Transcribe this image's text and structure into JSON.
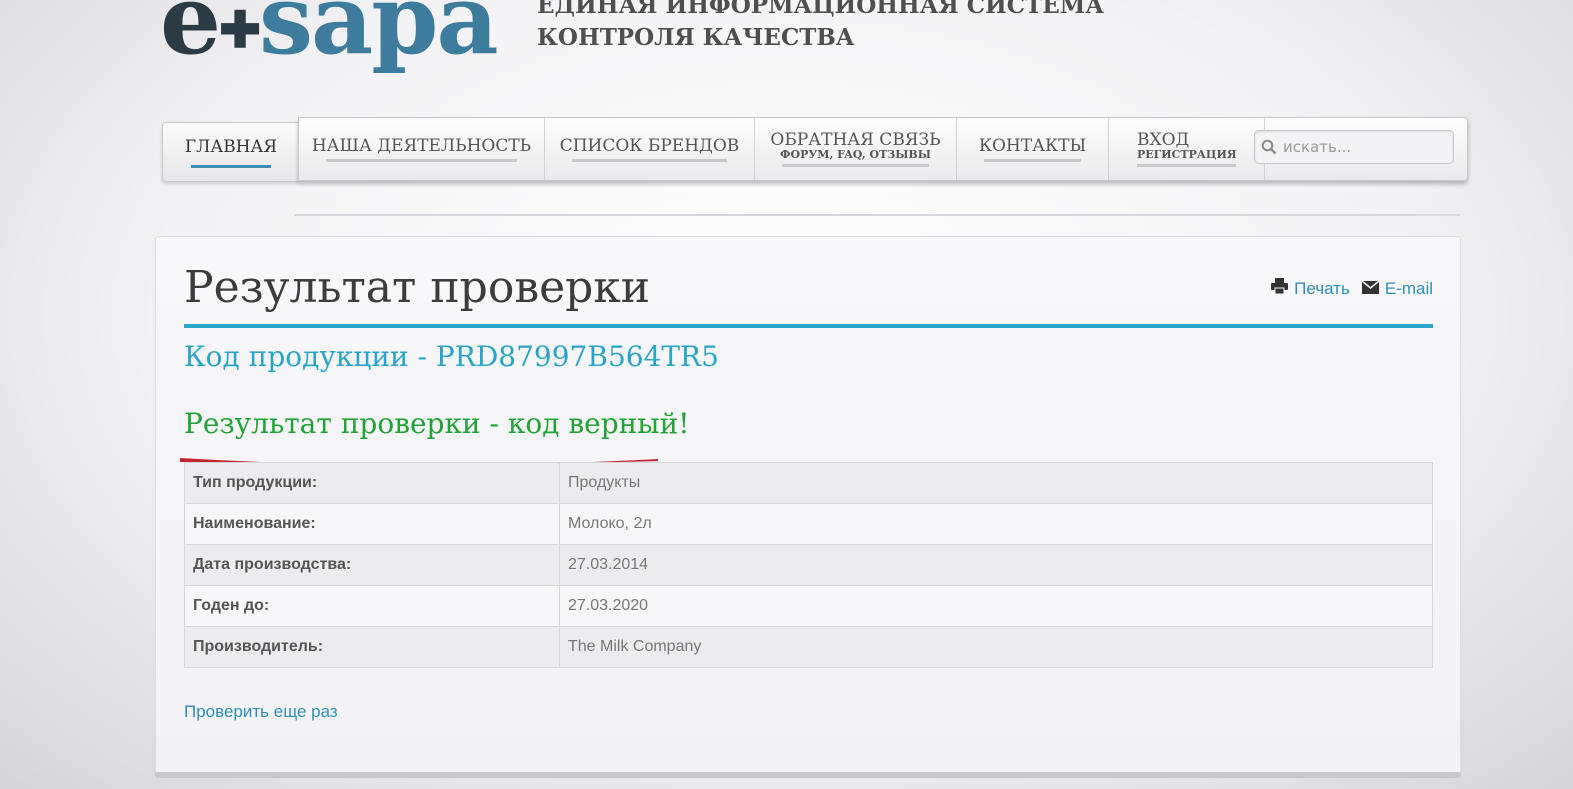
{
  "header": {
    "logo": {
      "e": "e",
      "sapa": "sapa"
    },
    "title_line1": "ЕДИНАЯ ИНФОРМАЦИОННАЯ СИСТЕМА",
    "title_line2": "КОНТРОЛЯ КАЧЕСТВА"
  },
  "nav": {
    "home": "ГЛАВНАЯ",
    "items": [
      {
        "label": "НАША ДЕЯТЕЛЬНОСТЬ",
        "sub": ""
      },
      {
        "label": "СПИСОК БРЕНДОВ",
        "sub": ""
      },
      {
        "label": "ОБРАТНАЯ СВЯЗЬ",
        "sub": "ФОРУМ, FAQ, ОТЗЫВЫ"
      },
      {
        "label": "КОНТАКТЫ",
        "sub": ""
      },
      {
        "label": "ВХОД",
        "sub": "РЕГИСТРАЦИЯ"
      }
    ],
    "search_placeholder": "искать..."
  },
  "content": {
    "page_title": "Результат проверки",
    "print_label": "Печать",
    "email_label": "E-mail",
    "product_code": "Код продукции - PRD87997B564TR5",
    "result": "Результат проверки - код верный!",
    "rows": [
      {
        "label": "Тип продукции:",
        "value": "Продукты"
      },
      {
        "label": "Наименование:",
        "value": "Молоко, 2л"
      },
      {
        "label": "Дата производства:",
        "value": "27.03.2014"
      },
      {
        "label": "Годен до:",
        "value": "27.03.2020"
      },
      {
        "label": "Производитель:",
        "value": "The Milk Company"
      }
    ],
    "check_again": "Проверить еще раз"
  },
  "colors": {
    "accent": "#2aa4c9",
    "success": "#22a336",
    "logo_dark": "#2b3b46",
    "logo_blue": "#3d7c9c",
    "annotation_red": "#c3242d"
  },
  "icons": [
    "print-icon",
    "mail-icon",
    "search-icon"
  ]
}
